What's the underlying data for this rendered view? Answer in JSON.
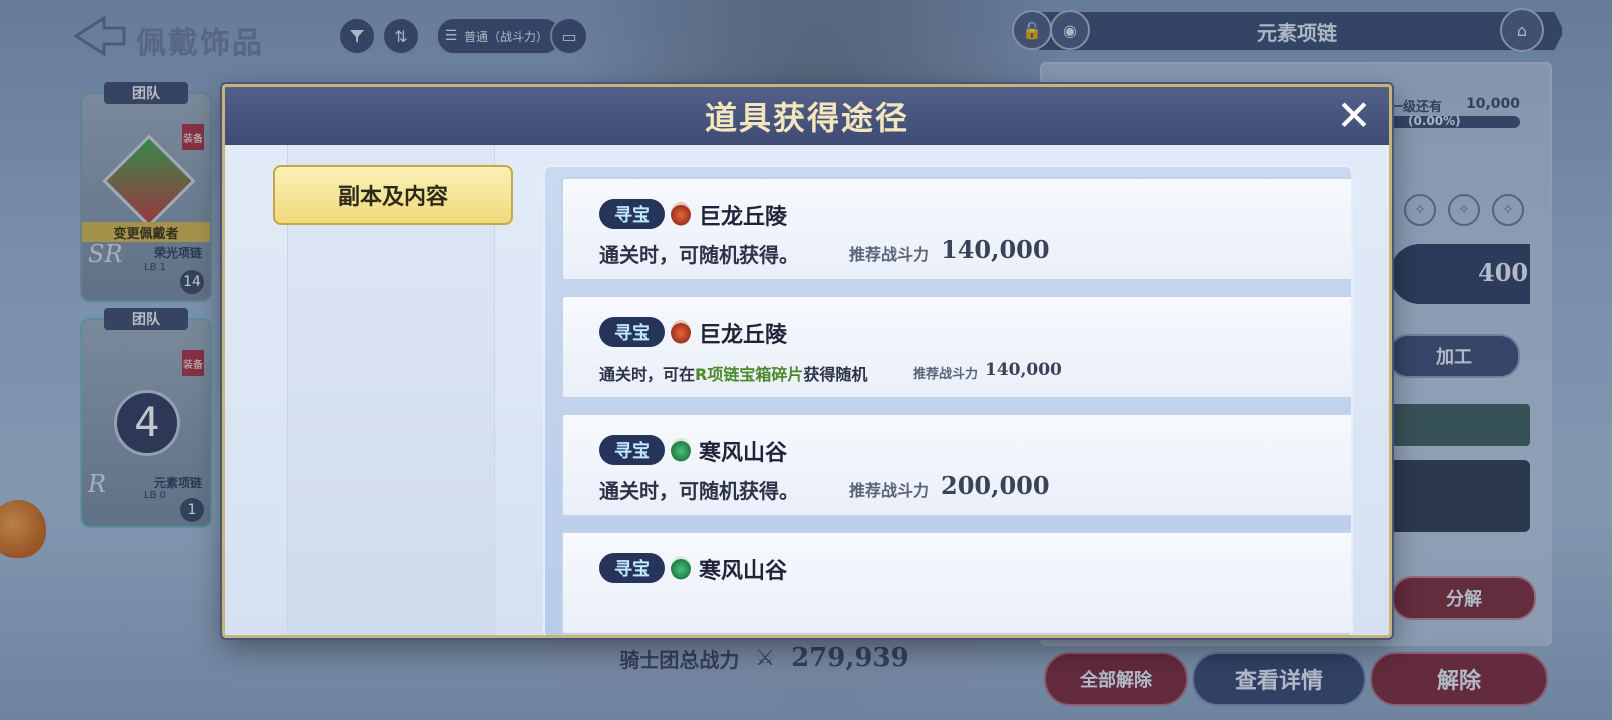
{
  "header": {
    "page_title": "佩戴饰品",
    "sort_label": "普通（战斗力）"
  },
  "right_header": {
    "title": "元素项链"
  },
  "right_panel": {
    "next_level_label": "一级还有",
    "next_level_value": "10,000",
    "percent": "(0.00%)",
    "power_value": "400",
    "process_button": "加工",
    "decompose_button": "分解"
  },
  "cards": [
    {
      "team_label": "团队",
      "equip_label": "装备",
      "change_label": "变更佩戴者",
      "rank": "SR",
      "name": "荣光项链",
      "lb": "LB 1",
      "count": "14"
    },
    {
      "team_label": "团队",
      "equip_label": "装备",
      "level_badge": "4",
      "rank": "R",
      "name": "元素项链",
      "lb": "LB 0",
      "count": "1"
    }
  ],
  "bottom": {
    "total_power_label": "骑士团总战力",
    "total_power_value": "279,939",
    "unequip_all_button": "全部解除",
    "details_button": "查看详情",
    "unequip_button": "解除"
  },
  "modal": {
    "title": "道具获得途径",
    "category": "副本及内容",
    "entries": [
      {
        "tag": "寻宝",
        "icon": "fire-element-icon",
        "name": "巨龙丘陵",
        "desc": "通关时，可随机获得。",
        "rec_label": "推荐战斗力",
        "rec_value": "140,000"
      },
      {
        "tag": "寻宝",
        "icon": "fire-element-icon",
        "name": "巨龙丘陵",
        "desc_before": "通关时，可在",
        "desc_highlight": "R项链宝箱碎片",
        "desc_after": "获得随机",
        "rec_label": "推荐战斗力",
        "rec_value": "140,000"
      },
      {
        "tag": "寻宝",
        "icon": "wind-element-icon",
        "name": "寒风山谷",
        "desc": "通关时，可随机获得。",
        "rec_label": "推荐战斗力",
        "rec_value": "200,000"
      },
      {
        "tag": "寻宝",
        "icon": "wind-element-icon",
        "name": "寒风山谷"
      }
    ]
  },
  "colors": {
    "modal_header": "#3e4c74",
    "title_gold": "#f3e6bc",
    "category_gold": "#f1db7c",
    "tag_navy": "#26335a",
    "highlight_green": "#4a8a2c"
  }
}
